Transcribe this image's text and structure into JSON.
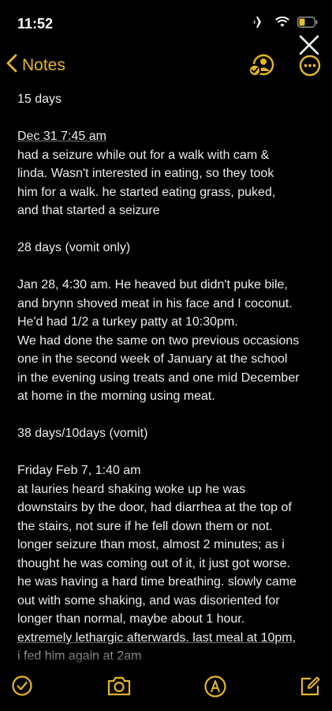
{
  "status": {
    "time": "11:52"
  },
  "nav": {
    "back_label": "Notes"
  },
  "note": {
    "paragraphs": [
      {
        "lines": [
          "15 days"
        ]
      },
      {
        "lines": [
          "Dec 31 7:45 am",
          "had a seizure while out for a walk with cam &",
          "linda. Wasn't interested in eating, so they took",
          "him for a walk. he started eating grass, puked,",
          "and that started a seizure"
        ]
      },
      {
        "lines": [
          "28 days (vomit only)"
        ]
      },
      {
        "lines": [
          "Jan 28, 4:30 am. He heaved but didn't puke bile,",
          "and brynn shoved meat in his face and I coconut.",
          "He'd had 1/2 a turkey patty at 10:30pm.",
          "We had done the same on two previous occasions",
          "one in the second week of January at the school",
          "in the evening using treats and one mid December",
          "at home in the morning using meat."
        ]
      },
      {
        "lines": [
          "38 days/10days (vomit)"
        ]
      },
      {
        "lines": [
          "Friday Feb 7, 1:40 am",
          "at lauries heard shaking woke up he was",
          "downstairs by the door, had diarrhea at the top of",
          "the stairs, not sure if he fell down them or not.",
          "longer seizure than most, almost 2 minutes; as i",
          "thought he was coming out of it, it just got worse.",
          "he was having a hard time breathing. slowly came",
          "out with some shaking, and was disoriented for",
          "longer than normal, maybe about 1 hour.",
          "extremely lethargic afterwards. last meal at 10pm,",
          "i fed him again at 2am"
        ]
      }
    ]
  },
  "colors": {
    "accent": "#e6b629",
    "background": "#000000",
    "text": "#ececec"
  },
  "icons": {
    "status": [
      "airplane-icon",
      "wifi-icon",
      "battery-icon"
    ],
    "nav": [
      "back-chevron-icon",
      "share-person-icon",
      "more-icon",
      "close-icon"
    ],
    "toolbar": [
      "checklist-icon",
      "camera-icon",
      "markup-pen-icon",
      "compose-icon"
    ]
  }
}
